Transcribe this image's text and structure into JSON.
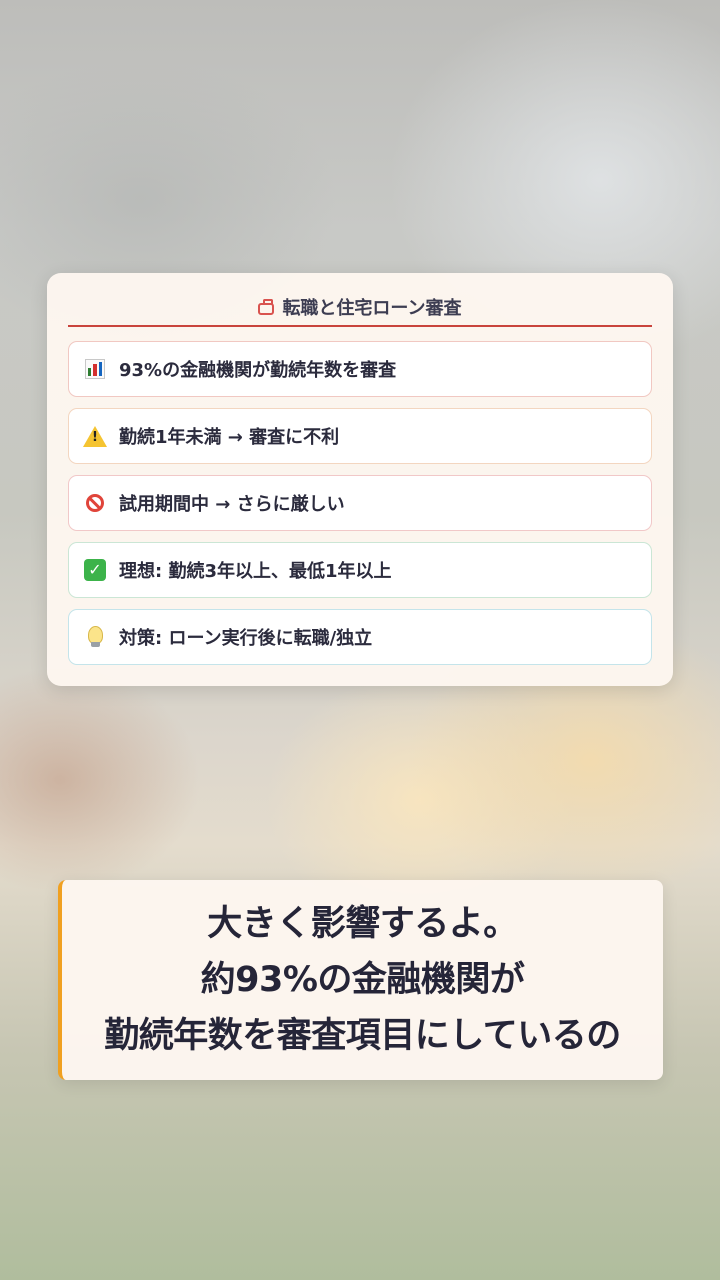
{
  "card": {
    "title": "転職と住宅ローン審査",
    "title_icon": "briefcase-icon",
    "accent_color": "#c9443c",
    "items": [
      {
        "icon": "bar-chart-icon",
        "text": "93%の金融機関が勤続年数を審査"
      },
      {
        "icon": "warning-icon",
        "text": "勤続1年未満 → 審査に不利"
      },
      {
        "icon": "no-entry-icon",
        "text": "試用期間中 → さらに厳しい"
      },
      {
        "icon": "check-mark-icon",
        "text": "理想: 勤続3年以上、最低1年以上"
      },
      {
        "icon": "light-bulb-icon",
        "text": "対策: ローン実行後に転職/独立"
      }
    ]
  },
  "caption": {
    "lines": [
      "大きく影響するよ。",
      "約93%の金融機関が",
      "勤続年数を審査項目にしているの"
    ],
    "accent_color": "#f0a020"
  }
}
